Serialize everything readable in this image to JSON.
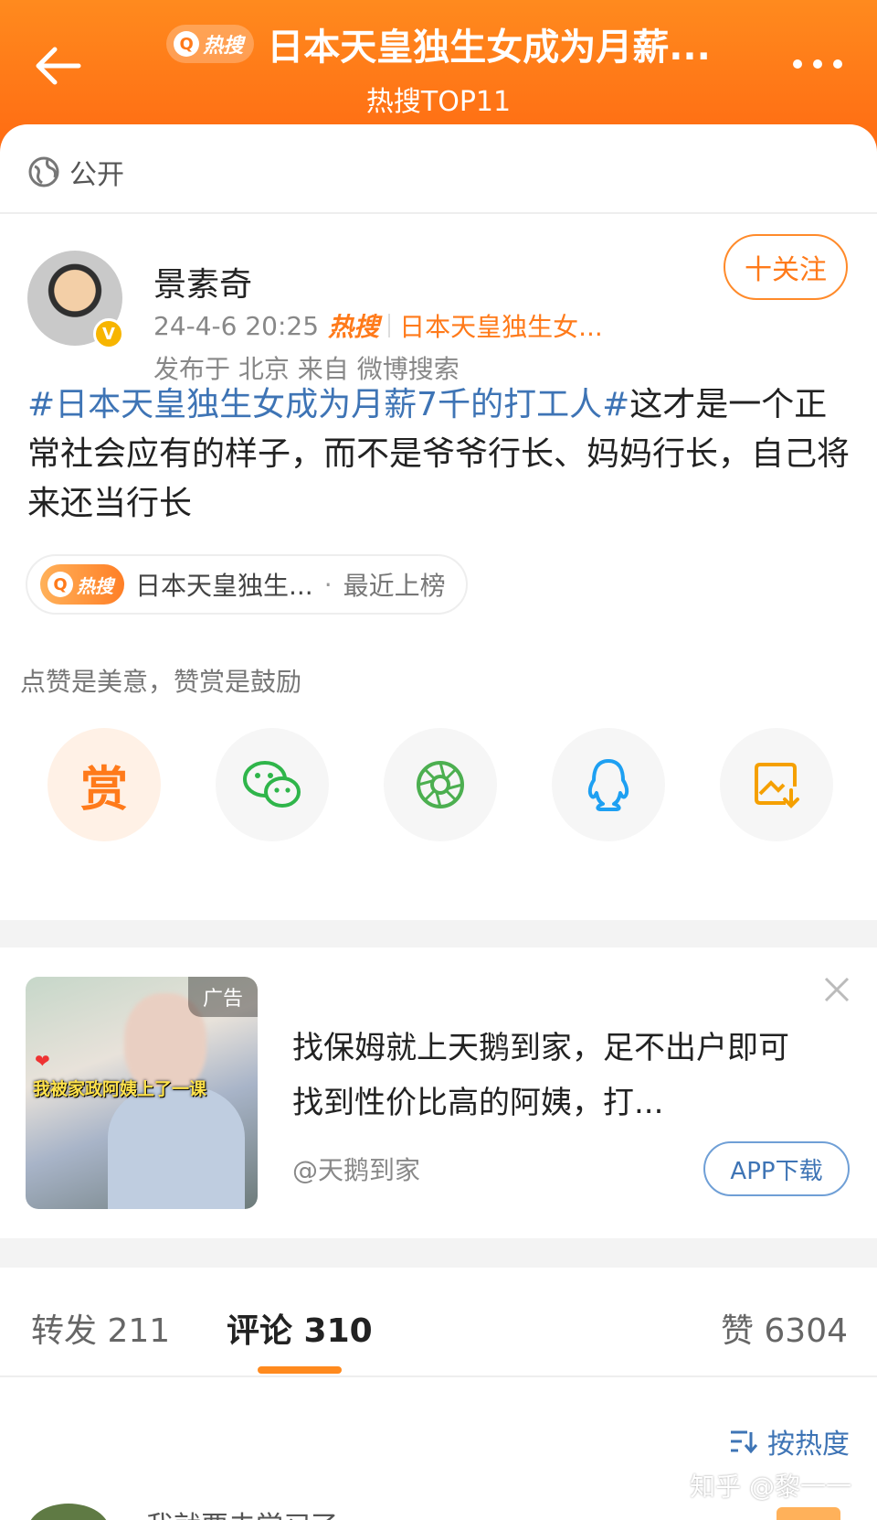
{
  "header": {
    "hot_badge": "热搜",
    "title": "日本天皇独生女成为月薪...",
    "subtitle": "热搜TOP11"
  },
  "post": {
    "visibility": "公开",
    "author": {
      "name": "景素奇"
    },
    "timestamp": "24-4-6 20:25",
    "hot_label": "热搜",
    "hot_topic": "日本天皇独生女...",
    "location_source": "发布于 北京   来自 微博搜索",
    "follow_label": "十关注",
    "hashtag": "#日本天皇独生女成为月薪7千的打工人#",
    "body": "这才是一个正常社会应有的样子，而不是爷爷行长、妈妈行长，自己将来还当行长",
    "topic_chip": {
      "badge": "热搜",
      "topic": "日本天皇独生...",
      "dot": "·",
      "status": "最近上榜"
    },
    "reward_tip": "点赞是美意，赞赏是鼓励",
    "reward_label": "赏"
  },
  "share_icons": [
    "reward-icon",
    "wechat-icon",
    "moments-icon",
    "qq-icon",
    "save-image-icon"
  ],
  "ad": {
    "label": "广告",
    "image_caption": "我被家政阿姨上了一课",
    "text": "找保姆就上天鹅到家，足不出户即可找到性价比高的阿姨，打...",
    "source": "@天鹅到家",
    "cta": "APP下载"
  },
  "tabs": {
    "repost": "转发 211",
    "comments": "评论 310",
    "likes": "赞 6304"
  },
  "sort": {
    "label": "按热度"
  },
  "watermark": "知乎 @黎一一",
  "comment_peek": "我就要去学习了",
  "colors": {
    "accent": "#ff7a1a",
    "link": "#3e74b5",
    "header_gradient_top": "#ff8a1e",
    "header_gradient_bottom": "#ff6a12"
  }
}
